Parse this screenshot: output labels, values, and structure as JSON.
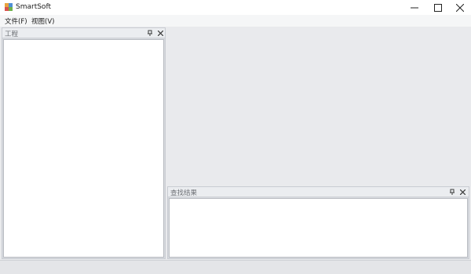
{
  "window": {
    "title": "SmartSoft",
    "icon": "app-icon",
    "controls": [
      "minimize-icon",
      "maximize-icon",
      "close-icon"
    ]
  },
  "menu": {
    "file_label": "文件(F)",
    "view_label": "视图(V)"
  },
  "panels": {
    "project": {
      "title": "工程",
      "pin_glyph": "ᵿ",
      "close_glyph": "✕"
    },
    "results": {
      "title": "查找结果",
      "pin_glyph": "ᵿ",
      "close_glyph": "✕"
    }
  },
  "colors": {
    "workspace": "#e9eaed",
    "panel_header": "#ebedf0",
    "panel_body": "#ffffff"
  }
}
